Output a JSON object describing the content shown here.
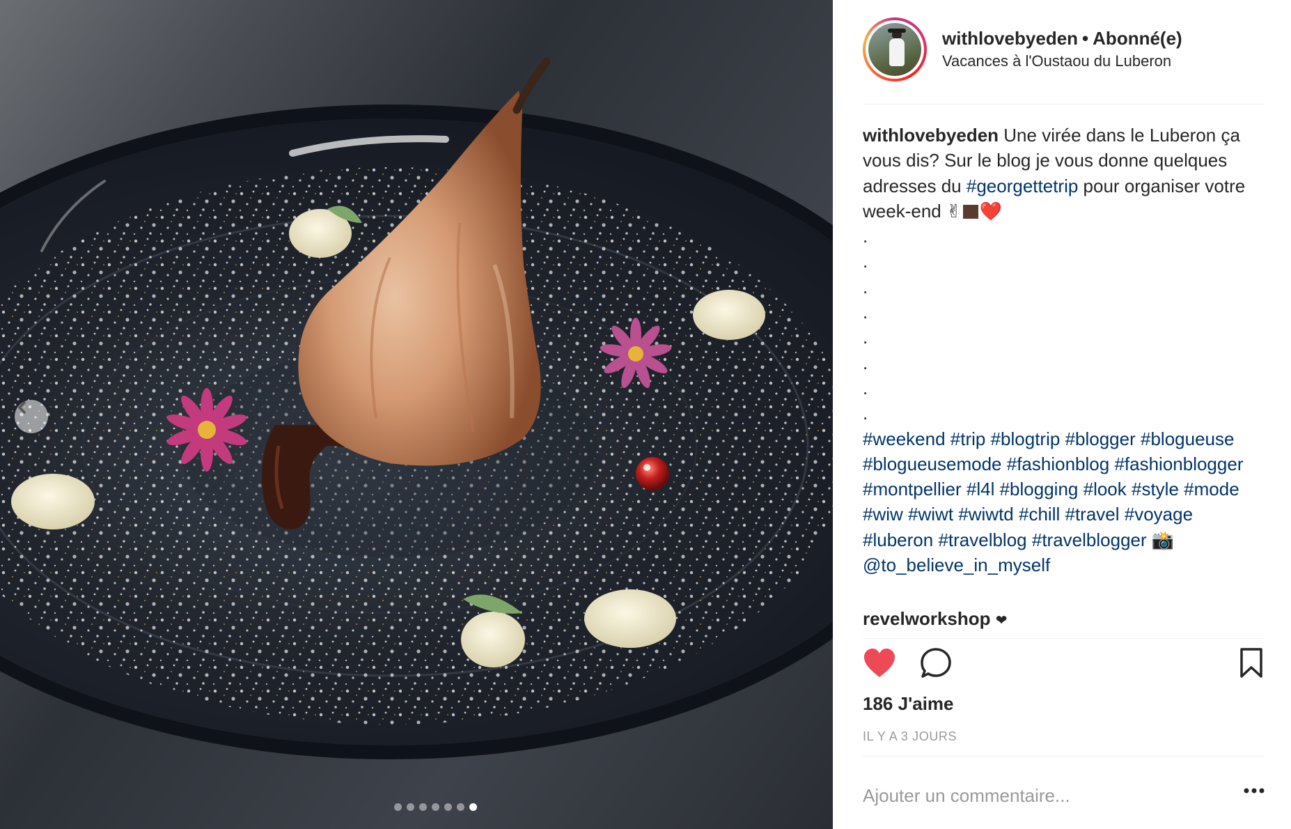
{
  "post": {
    "carousel": {
      "slide_count": 7,
      "active_slide": 7
    },
    "header": {
      "username": "withlovebyeden",
      "separator": "•",
      "follow_status": "Abonné(e)",
      "location": "Vacances à l'Oustaou du Luberon"
    },
    "caption": {
      "username": "withlovebyeden",
      "text_before_tag": " Une virée dans le Luberon ça vous dis? Sur le blog je vous donne quelques adresses du ",
      "inline_tag": "#georgettetrip",
      "text_after_tag": " pour organiser votre week-end ✌",
      "heart_emoji": "❤️",
      "dots": [
        ".",
        ".",
        ".",
        ".",
        ".",
        ".",
        ".",
        "."
      ],
      "hashtags": [
        "#weekend",
        "#trip",
        "#blogtrip",
        "#blogger",
        "#blogueuse",
        "#blogueusemode",
        "#fashionblog",
        "#fashionblogger",
        "#montpellier",
        "#l4l",
        "#blogging",
        "#look",
        "#style",
        "#mode",
        "#wiw",
        "#wiwt",
        "#wiwtd",
        "#chill",
        "#travel",
        "#voyage",
        "#luberon",
        "#travelblog",
        "#travelblogger"
      ],
      "camera_emoji": "📸",
      "mention": "@to_believe_in_myself"
    },
    "comments": [
      {
        "username": "revelworkshop",
        "text": "❤"
      }
    ],
    "actions": {
      "like_icon": "heart-filled-icon",
      "comment_icon": "speech-bubble-icon",
      "save_icon": "bookmark-icon",
      "like_color": "#ed4956"
    },
    "likes": "186 J'aime",
    "timestamp": "IL Y A 3 JOURS",
    "add_comment": {
      "placeholder": "Ajouter un commentaire..."
    },
    "more_icon": "ellipsis-icon"
  }
}
